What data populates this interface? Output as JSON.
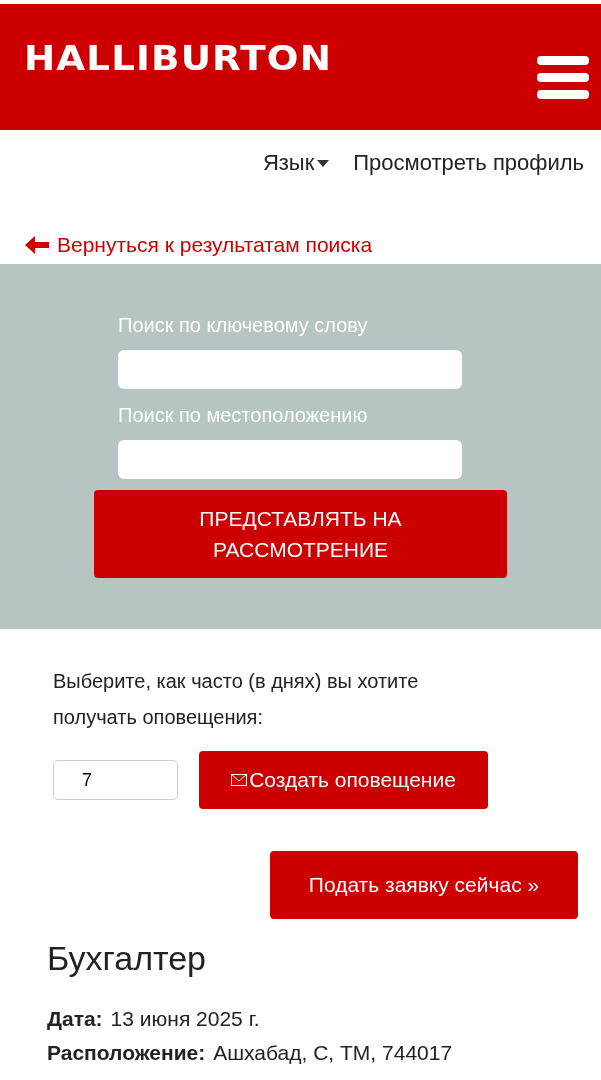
{
  "header": {
    "logo": "HALLIBURTON"
  },
  "nav": {
    "language": "Язык",
    "profile": "Просмотреть профиль"
  },
  "back_link": "Вернуться к результатам поиска",
  "search": {
    "keyword_label": "Поиск по ключевому слову",
    "location_label": "Поиск по местоположению",
    "submit": "ПРЕДСТАВЛЯТЬ НА РАССМОТРЕНИЕ"
  },
  "alert": {
    "prompt": "Выберите, как часто (в днях) вы хотите получать оповещения:",
    "days": "7",
    "button": "Создать оповещение"
  },
  "apply_button": "Подать заявку сейчас »",
  "job": {
    "title": "Бухгалтер",
    "details": [
      {
        "label": "Дата:",
        "value": "13 июня 2025 г."
      },
      {
        "label": "Расположение:",
        "value": "Ашхабад, С, ТМ, 744017"
      }
    ]
  }
}
